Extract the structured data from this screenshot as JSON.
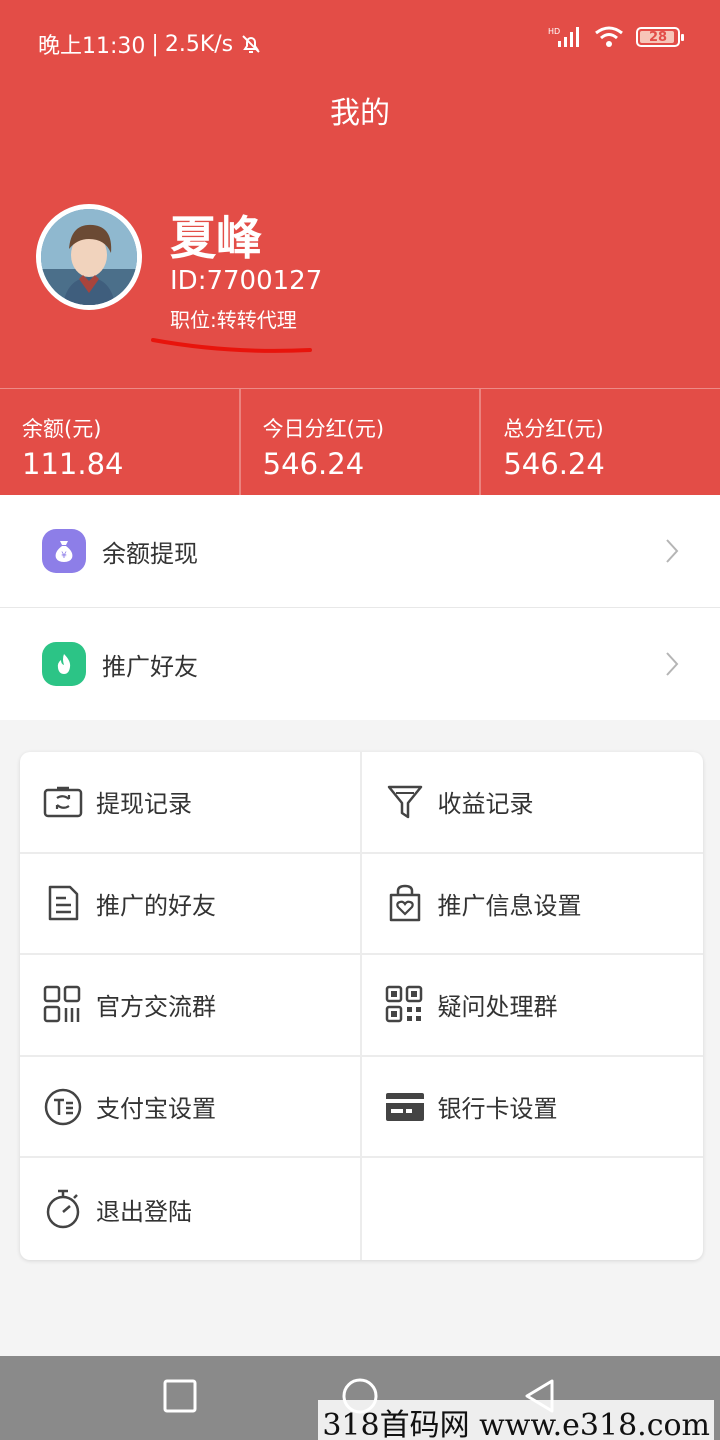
{
  "status_bar": {
    "time": "晚上11:30",
    "speed": "2.5K/s",
    "battery": "28"
  },
  "header": {
    "title": "我的"
  },
  "user": {
    "name": "夏峰",
    "id": "ID:7700127",
    "position": "职位:转转代理"
  },
  "stats": [
    {
      "label": "余额(元)",
      "value": "111.84"
    },
    {
      "label": "今日分红(元)",
      "value": "546.24"
    },
    {
      "label": "总分红(元)",
      "value": "546.24"
    }
  ],
  "list_items": [
    {
      "label": "余额提现",
      "icon": "money-bag-icon",
      "color": "#8d7ee8"
    },
    {
      "label": "推广好友",
      "icon": "flame-icon",
      "color": "#2cc486"
    }
  ],
  "grid_items": [
    {
      "label": "提现记录",
      "icon": "withdraw-record-icon"
    },
    {
      "label": "收益记录",
      "icon": "filter-icon"
    },
    {
      "label": "推广的好友",
      "icon": "document-icon"
    },
    {
      "label": "推广信息设置",
      "icon": "shopping-bag-icon"
    },
    {
      "label": "官方交流群",
      "icon": "grid-qr-icon"
    },
    {
      "label": "疑问处理群",
      "icon": "qr-code-icon"
    },
    {
      "label": "支付宝设置",
      "icon": "alipay-icon"
    },
    {
      "label": "银行卡设置",
      "icon": "bank-card-icon"
    },
    {
      "label": "退出登陆",
      "icon": "stopwatch-icon"
    }
  ],
  "watermark": "318首码网 www.e318.com",
  "colors": {
    "brand_red": "#e34d47",
    "text_dark": "#333333",
    "background": "#f4f4f4"
  }
}
